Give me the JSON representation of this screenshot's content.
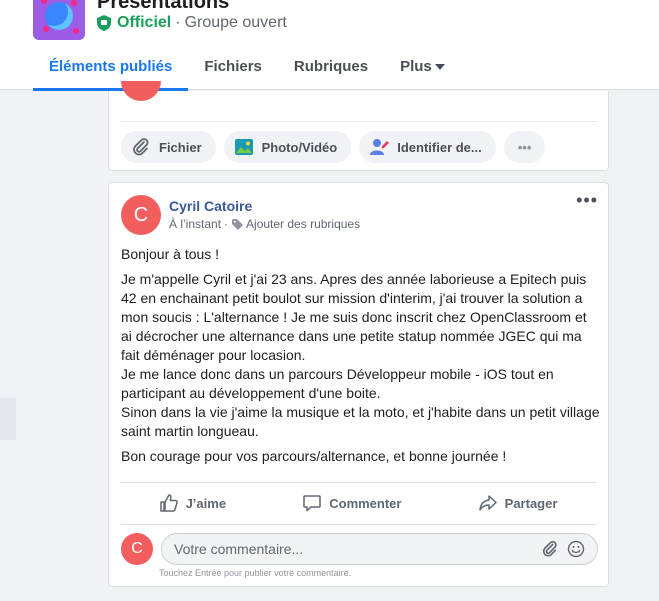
{
  "group": {
    "title": "Présentations",
    "badge": "Officiel",
    "separator": "·",
    "privacy": "Groupe ouvert"
  },
  "tabs": [
    {
      "label": "Éléments publiés",
      "active": true
    },
    {
      "label": "Fichiers",
      "active": false
    },
    {
      "label": "Rubriques",
      "active": false
    },
    {
      "label": "Plus",
      "active": false
    }
  ],
  "composer": {
    "actions": [
      {
        "label": "Fichier",
        "icon": "paperclip-icon"
      },
      {
        "label": "Photo/Vidéo",
        "icon": "photo-icon"
      },
      {
        "label": "Identifier de...",
        "icon": "tag-people-icon"
      },
      {
        "label": "•••",
        "icon": "more-icon"
      }
    ]
  },
  "post": {
    "avatar_letter": "C",
    "author": "Cyril Catoire",
    "time": "À l’instant",
    "meta_sep": "·",
    "add_topics": "Ajouter des rubriques",
    "more": "•••",
    "paragraphs": [
      "Bonjour à tous !",
      "Je m'appelle Cyril et j'ai 23 ans. Apres des année laborieuse a Epitech puis 42 en enchainant petit boulot sur mission d'interim, j'ai trouver la solution a mon soucis : L'alternance ! Je me suis donc inscrit chez OpenClassroom et ai décrocher une alternance dans une petite statup nommée JGEC qui ma fait déménager pour locasion.\nJe me lance donc dans un parcours Développeur mobile - iOS tout en participant au développement d'une boite.\nSinon dans la vie j'aime la musique et la moto, et j'habite dans un petit village saint martin longueau.",
      "Bon courage pour vos parcours/alternance, et bonne journée !"
    ],
    "like_label": "J’aime",
    "comment_label": "Commenter",
    "share_label": "Partager",
    "comment_placeholder": "Votre commentaire...",
    "comment_hint": "Touchez Entrée pour publier votre commentaire."
  },
  "colors": {
    "accent": "#1877f2",
    "official_green": "#1aa05a",
    "avatar_red": "#f25e5e",
    "author_blue": "#385898"
  }
}
